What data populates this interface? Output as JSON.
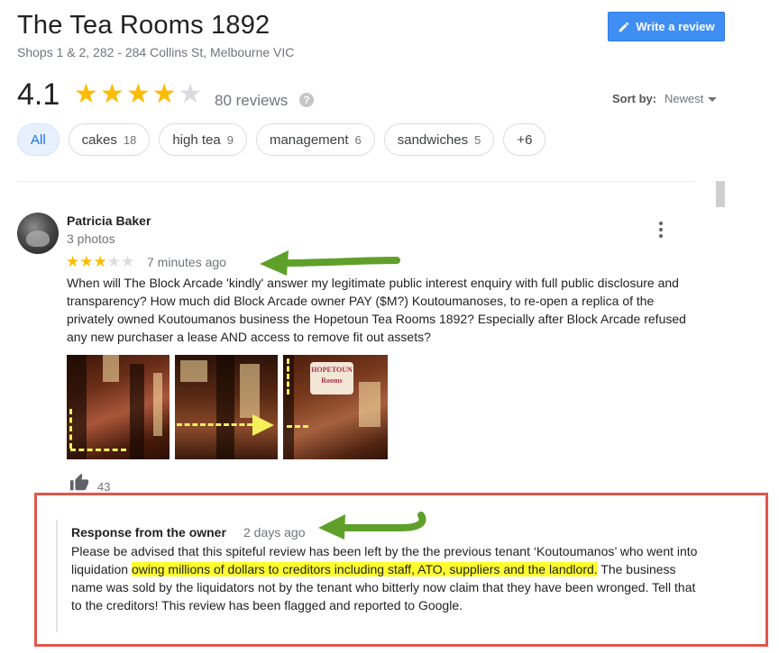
{
  "place": {
    "name": "The Tea Rooms 1892",
    "address": "Shops 1 & 2, 282 - 284 Collins St, Melbourne VIC"
  },
  "write_review": {
    "label": "Write a review",
    "icon": "pencil-icon",
    "color": "#3f8ef3"
  },
  "summary": {
    "rating": "4.1",
    "stars_filled": 4,
    "stars_total": 5,
    "reviews_label": "80 reviews",
    "help_glyph": "?"
  },
  "sort": {
    "label": "Sort by:",
    "value": "Newest"
  },
  "chips": [
    {
      "label": "All",
      "count": "",
      "active": true
    },
    {
      "label": "cakes",
      "count": "18",
      "active": false
    },
    {
      "label": "high tea",
      "count": "9",
      "active": false
    },
    {
      "label": "management",
      "count": "6",
      "active": false
    },
    {
      "label": "sandwiches",
      "count": "5",
      "active": false
    },
    {
      "label": "+6",
      "count": "",
      "active": false
    }
  ],
  "review": {
    "author": "Patricia Baker",
    "subtitle": "3 photos",
    "stars_filled": 3,
    "stars_total": 5,
    "time": "7 minutes ago",
    "text": "When will The Block Arcade 'kindly' answer my legitimate public interest enquiry with full public disclosure and transparency? How much did Block Arcade owner PAY ($M?) Koutoumanoses, to re-open a replica of the privately owned Koutoumanos business the Hopetoun Tea Rooms 1892? Especially after Block Arcade refused any new purchaser a lease AND access to remove fit out assets?",
    "photo3_sign": "HOPETOUN Rooms",
    "likes": "43"
  },
  "owner_response": {
    "heading": "Response from the owner",
    "time": "2 days ago",
    "text_before": "Please be advised that this spiteful review has been left by the the previous tenant ‘Koutoumanos’ who went into liquidation ",
    "text_highlight": "owing millions of dollars to creditors including staff, ATO, suppliers and the landlord.",
    "text_after": " The business name was sold by the liquidators not by the tenant who bitterly now claim that they have been wronged. Tell that to the creditors! This review has been flagged and reported to Google."
  },
  "colors": {
    "star_filled": "#fbbc04",
    "star_empty": "#dadce0",
    "annotation_arrow": "#5fa02a",
    "annotation_box": "#e0564a",
    "highlight": "#ffff2e"
  }
}
